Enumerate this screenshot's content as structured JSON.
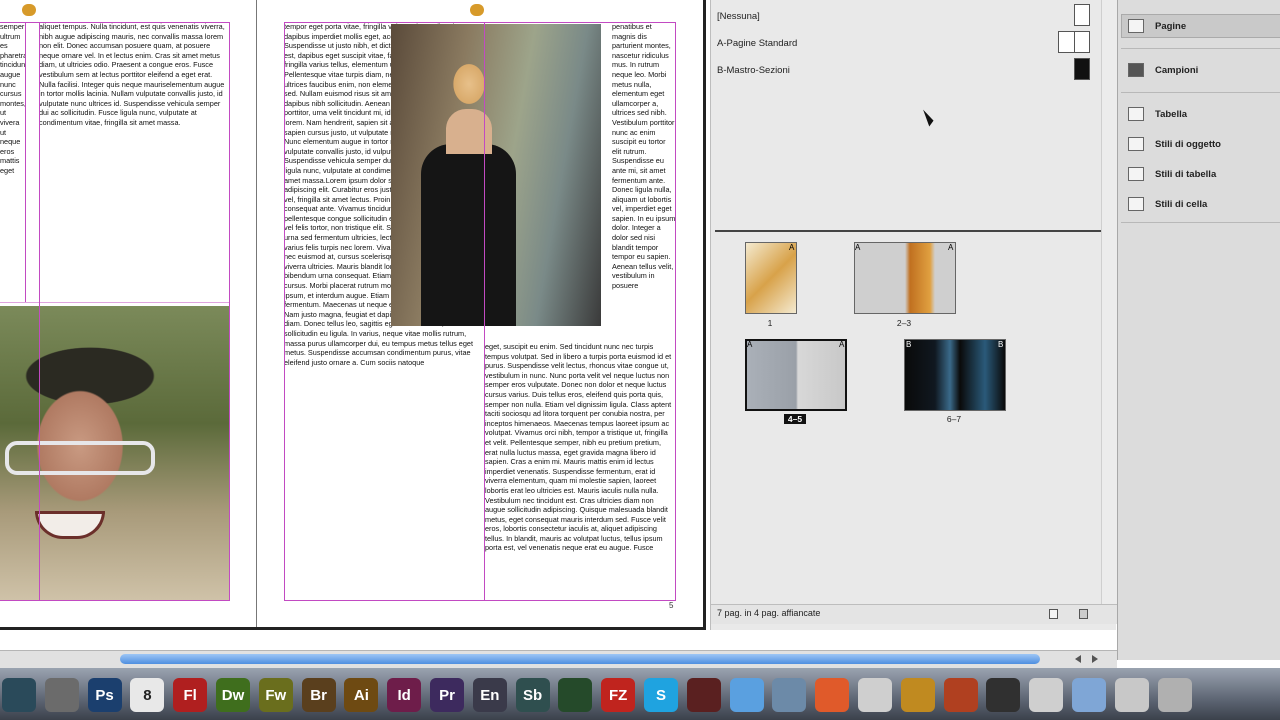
{
  "document": {
    "left_text": "aliquet tempus. Nulla tincidunt, est quis venenatis viverra, nibh augue adipiscing mauris, nec convallis massa lorem non elit. Donec accumsan posuere quam, at posuere neque ornare vel. In et lectus enim. Cras sit amet metus diam, ut ultricies odio. Praesent a congue eros. Fusce vestibulum sem at lectus porttitor eleifend a eget erat. Nulla facilisi. Integer quis neque mauriselementum augue in tortor mollis lacinia. Nullam vulputate convallis justo, id vulputate nunc ultrices id. Suspendisse vehicula semper dui ac sollicitudin. Fusce ligula nunc, vulputate at condimentum vitae, fringilla sit amet massa.",
    "left_fragment_text": "semper ultrum es pharetra tincidunt augue nunc cursus montes, ut vivera ut neque eros mattis eget",
    "mid_text": "tempor eget porta vitae, fringilla vel mauris. Ut diam lorem, dapibus imperdiet mollis eget, accumsan id mauris. Suspendisse ut justo nibh, et dictum diam. Vestibulum elit est, dapibus eget suscipit vitae, faucibus id augue. Etiam fringilla varius tellus, elementum ultrices odio lobortis sed. Pellentesque vitae turpis diam, nec aliquam sem. Aliquam ultrices faucibus enim, non elementum mauris consequat sed. Nullam euismod risus sit amet turpis vestibulum in dapibus nibh sollicitudin. Aenean tristique, elit eu rutrum porttitor, urna velit tincidunt mi, id ornare lacus ligula vitae lorem. Nam hendrerit, sapien sit amet porttitor cursus, mi sapien cursus justo, ut vulputate nunc magna quis arcu. Nunc elementum augue in tortor mollis lacinia. Nullam vulputate convallis justo, id vulputate nunc ultrices id. Suspendisse vehicula semper dui ac sollicitudin. Fusce ligula nunc, vulputate at condimentum vitae, fringilla sit amet massa.Lorem ipsum dolor sit amet, consectetur adipiscing elit. Curabitur eros justo, dignissim quis dapibus vel, fringilla sit amet lectus. Proin eu dolor est, sit amet consequat ante. Vivamus tincidunt risus et odio pellentesque congue sollicitudin est dapibus. Suspendisse vel felis tortor, non tristique elit. Suspendisse rhoncus, urna sed fermentum ultricies, lectus urna dictum tortor, vel varius felis turpis nec lorem. Vivamus dolor dolor, cursus nec euismod at, cursus scelerisque metus. Ut sagittis viverra ultricies. Mauris blandit lorem ut justo egestas non bibendum urna consequat. Etiam accumsan fringilla cursus. Morbi placerat rutrum molestie. Fusce sed elit ipsum, et interdum augue. Etiam ultrices auctor fermentum. Maecenas ut neque et erat blandit malesuada. Nam justo magna, feugiat et dapibus sed, tincidunt quis diam. Donec tellus leo, sagittis eget molestie sed, sollicitudin eu ligula. In varius, neque vitae mollis rutrum, massa purus ullamcorper dui, eu tempus metus tellus eget metus. Suspendisse accumsan condimentum purus, vitae eleifend justo ornare a. Cum sociis natoque",
    "right_narrow_text": "penatibus et magnis dis parturient montes, nascetur ridiculus mus. In rutrum neque leo. Morbi metus nulla, elementum eget ullamcorper a, ultrices sed nibh. Vestibulum porttitor nunc ac enim suscipit eu tortor elit rutrum. Suspendisse eu ante mi, sit amet fermentum ante. Donec ligula nulla, aliquam ut lobortis vel, imperdiet eget sapien. In eu ipsum dolor. Integer a dolor sed nisi blandit tempor tempor eu sapien. Aenean tellus velit, vestibulum in posuere",
    "right_bottom_text": "eget, suscipit eu enim. Sed tincidunt nunc nec turpis tempus volutpat. Sed in libero a turpis porta euismod id et purus. Suspendisse velit lectus, rhoncus vitae congue ut, vestibulum in nunc. Nunc porta velit vel neque luctus non semper eros vulputate. Donec non dolor et neque luctus cursus varius. Duis tellus eros, eleifend quis porta quis, semper non nulla. Etiam vel dignissim ligula. Class aptent taciti sociosqu ad litora torquent per conubia nostra, per inceptos himenaeos. Maecenas tempus laoreet ipsum ac volutpat. Vivamus orci nibh, tempor a tristique ut, fringilla et velit. Pellentesque semper, nibh eu pretium pretium, erat nulla luctus massa, eget gravida magna libero id sapien. Cras a enim mi. Mauris mattis enim id lectus imperdiet venenatis. Suspendisse fermentum, erat id viverra elementum, quam mi molestie sapien, laoreet lobortis erat leo ultricies est. Mauris iaculis nulla nulla. Vestibulum nec tincidunt est. Cras ultricies diam non augue sollicitudin adipiscing. Quisque malesuada blandit metus, eget consequat mauris interdum sed. Fusce velit eros, lobortis consectetur iaculis at, aliquet adipiscing tellus. In blandit, mauris ac volutpat luctus, tellus ipsum porta est, vel venenatis neque erat eu augue. Fusce",
    "page_number": "5"
  },
  "pages_panel": {
    "masters": [
      "[Nessuna]",
      "A-Pagine Standard",
      "B-Mastro-Sezioni"
    ],
    "page_labels": [
      "1",
      "2–3",
      "4–5",
      "6–7"
    ],
    "master_marks": {
      "a": "A",
      "b": "B"
    },
    "status": "7 pag. in 4 pag. affiancate"
  },
  "dock_panel": {
    "items": [
      "Pagine",
      "Campioni",
      "Tabella",
      "Stili di oggetto",
      "Stili di tabella",
      "Stili di cella"
    ]
  },
  "mac_dock": {
    "apps": [
      {
        "name": "time-machine",
        "label": "",
        "color": "#2a4a5a"
      },
      {
        "name": "system-prefs",
        "label": "",
        "color": "#6b6b6b"
      },
      {
        "name": "photoshop",
        "label": "Ps",
        "color": "#1b3f6e"
      },
      {
        "name": "ical",
        "label": "8",
        "color": "#e8e8e8"
      },
      {
        "name": "flash",
        "label": "Fl",
        "color": "#b01f1f"
      },
      {
        "name": "dreamweaver",
        "label": "Dw",
        "color": "#3f6e1d"
      },
      {
        "name": "fireworks",
        "label": "Fw",
        "color": "#6a6e1d"
      },
      {
        "name": "bridge",
        "label": "Br",
        "color": "#5a3f1d"
      },
      {
        "name": "illustrator",
        "label": "Ai",
        "color": "#6e4a12"
      },
      {
        "name": "indesign",
        "label": "Id",
        "color": "#6e1d4a"
      },
      {
        "name": "premiere",
        "label": "Pr",
        "color": "#3d2a5e"
      },
      {
        "name": "encore",
        "label": "En",
        "color": "#3a3a4a"
      },
      {
        "name": "soundbooth",
        "label": "Sb",
        "color": "#2f4f4f"
      },
      {
        "name": "film",
        "label": "",
        "color": "#254a2a"
      },
      {
        "name": "filezilla",
        "label": "FZ",
        "color": "#c0241e"
      },
      {
        "name": "skype",
        "label": "S",
        "color": "#1fa3e0"
      },
      {
        "name": "reader",
        "label": "",
        "color": "#5a2020"
      },
      {
        "name": "ichat",
        "label": "",
        "color": "#5aa0e0"
      },
      {
        "name": "mail",
        "label": "",
        "color": "#6c8aa8"
      },
      {
        "name": "shape",
        "label": "",
        "color": "#e05a2a"
      },
      {
        "name": "preview",
        "label": "",
        "color": "#cfcfcf"
      },
      {
        "name": "keynote",
        "label": "",
        "color": "#c08a20"
      },
      {
        "name": "photobooth",
        "label": "",
        "color": "#b04020"
      },
      {
        "name": "iphone",
        "label": "",
        "color": "#303030"
      },
      {
        "name": "app-folder",
        "label": "",
        "color": "#cfcfcf"
      },
      {
        "name": "folder",
        "label": "",
        "color": "#7fa6d6"
      },
      {
        "name": "downloads",
        "label": "",
        "color": "#c8c8c8"
      },
      {
        "name": "trash",
        "label": "",
        "color": "#b0b0b0"
      }
    ]
  }
}
